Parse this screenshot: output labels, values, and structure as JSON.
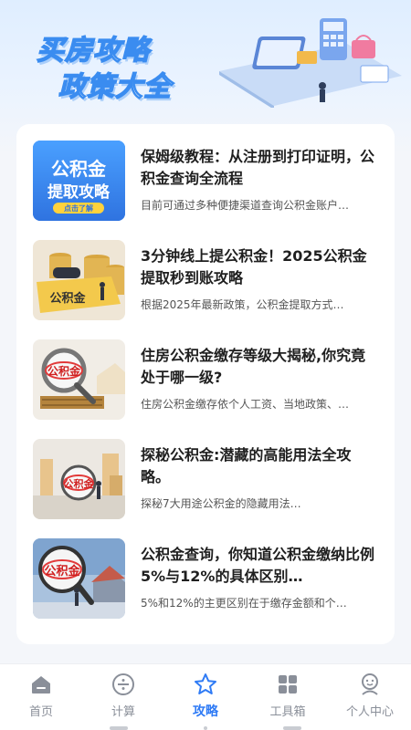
{
  "banner": {
    "title": "买房攻略",
    "subtitle": "政策大全"
  },
  "articles": [
    {
      "title": "保姆级教程：从注册到打印证明，公积金查询全流程",
      "desc": "目前可通过多种便捷渠道查询公积金账户…",
      "thumb_text": [
        "公积金",
        "提取攻略",
        "点击了解"
      ]
    },
    {
      "title": "3分钟线上提公积金！2025公积金提取秒到账攻略",
      "desc": "根据2025年最新政策，公积金提取方式…",
      "thumb_text": [
        "公积金"
      ]
    },
    {
      "title": "住房公积金缴存等级大揭秘,你究竟处于哪一级?",
      "desc": "住房公积金缴存依个人工资、当地政策、…",
      "thumb_text": [
        "公积金"
      ]
    },
    {
      "title": "探秘公积金:潜藏的高能用法全攻略。",
      "desc": "探秘7大用途公积金的隐藏用法…",
      "thumb_text": [
        "公积金"
      ]
    },
    {
      "title": "公积金查询，你知道公积金缴纳比例5%与12%的具体区别…",
      "desc": "5%和12%的主更区别在于缴存金额和个…",
      "thumb_text": [
        "公积金"
      ]
    }
  ],
  "tabs": [
    {
      "label": "首页",
      "icon": "home-icon"
    },
    {
      "label": "计算",
      "icon": "divide-icon"
    },
    {
      "label": "攻略",
      "icon": "star-icon",
      "active": true
    },
    {
      "label": "工具箱",
      "icon": "grid-icon"
    },
    {
      "label": "个人中心",
      "icon": "user-icon"
    }
  ],
  "colors": {
    "accent": "#2f7bf5",
    "inactive": "#8a8f99"
  }
}
